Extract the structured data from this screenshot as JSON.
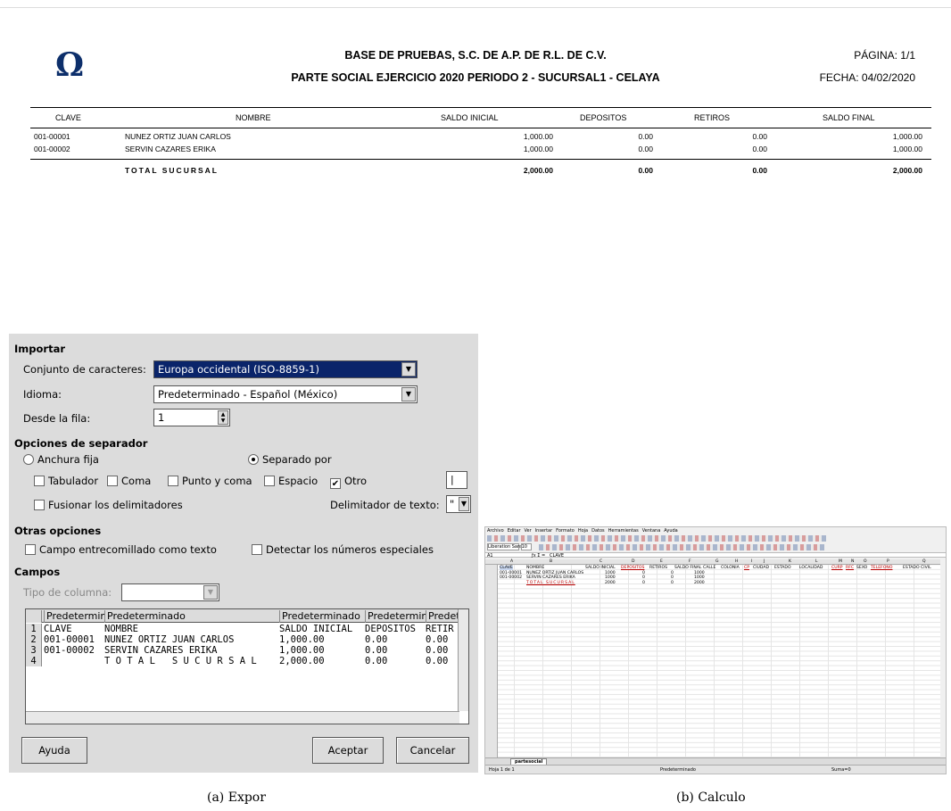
{
  "report": {
    "logo": "Ω",
    "title": "BASE DE PRUEBAS, S.C. DE A.P. DE R.L. DE C.V.",
    "subtitle": "PARTE SOCIAL EJERCICIO 2020 PERIODO 2 - SUCURSAL1 - CELAYA",
    "page": "PÁGINA: 1/1",
    "date": "FECHA: 04/02/2020",
    "columns": [
      "CLAVE",
      "NOMBRE",
      "SALDO INICIAL",
      "DEPOSITOS",
      "RETIROS",
      "SALDO FINAL"
    ],
    "rows": [
      [
        "001-00001",
        "NUNEZ ORTIZ JUAN CARLOS",
        "1,000.00",
        "0.00",
        "0.00",
        "1,000.00"
      ],
      [
        "001-00002",
        "SERVIN CAZARES ERIKA",
        "1,000.00",
        "0.00",
        "0.00",
        "1,000.00"
      ]
    ],
    "total": [
      "TOTAL SUCURSAL",
      "2,000.00",
      "0.00",
      "0.00",
      "2,000.00"
    ]
  },
  "dialog": {
    "section_import": "Importar",
    "charset_label": "Conjunto de caracteres:",
    "charset_value": "Europa occidental (ISO-8859-1)",
    "language_label": "Idioma:",
    "language_value": "Predeterminado - Español (México)",
    "from_row_label": "Desde la fila:",
    "from_row_value": "1",
    "section_separator": "Opciones de separador",
    "fixed_width": "Anchura fija",
    "separated_by": "Separado por",
    "tab": "Tabulador",
    "comma": "Coma",
    "semicolon": "Punto y coma",
    "space": "Espacio",
    "other": "Otro",
    "other_value": "|",
    "merge_delims": "Fusionar los delimitadores",
    "text_delim_label": "Delimitador de texto:",
    "text_delim_value": "\"",
    "section_other": "Otras opciones",
    "quoted_as_text": "Campo entrecomillado como texto",
    "detect_numbers": "Detectar los números especiales",
    "section_fields": "Campos",
    "column_type_label": "Tipo de columna:",
    "preview_headers": [
      "Predetermin",
      "Predeterminado",
      "Predeterminado",
      "Predetermin",
      "Predet"
    ],
    "preview_rows": [
      [
        "1",
        "CLAVE",
        "NOMBRE",
        "SALDO INICIAL",
        "DEPOSITOS",
        "RETIR"
      ],
      [
        "2",
        "001-00001",
        "NUNEZ ORTIZ JUAN CARLOS",
        "1,000.00",
        "0.00",
        "0.00"
      ],
      [
        "3",
        "001-00002",
        "SERVIN CAZARES ERIKA",
        "1,000.00",
        "0.00",
        "0.00"
      ],
      [
        "4",
        "",
        "T O T A L   S U C U R S A L",
        "2,000.00",
        "0.00",
        "0.00"
      ]
    ],
    "help_button": "Ayuda",
    "ok_button": "Aceptar",
    "cancel_button": "Cancelar"
  },
  "calc": {
    "menu": [
      "Archivo",
      "Editar",
      "Ver",
      "Insertar",
      "Formato",
      "Hoja",
      "Datos",
      "Herramientas",
      "Ventana",
      "Ayuda"
    ],
    "font": "Liberation Sans",
    "size": "10",
    "cell_ref": "A1",
    "formula": "CLAVE",
    "col_headers": [
      "A",
      "B",
      "C",
      "D",
      "E",
      "F",
      "G",
      "H",
      "I",
      "J",
      "K",
      "L",
      "M",
      "N",
      "O",
      "P",
      "Q"
    ],
    "header_row": [
      "CLAVE",
      "NOMBRE",
      "SALDO INICIAL",
      "DEPOSITOS",
      "RETIROS",
      "SALDO FINAL",
      "CALLE",
      "COLONIA",
      "CP",
      "CIUDAD",
      "ESTADO",
      "LOCALIDAD",
      "CURP",
      "RFC",
      "SEXO",
      "TELEFONO",
      "ESTADO CIVIL"
    ],
    "data_rows": [
      [
        "001-00001",
        "NUNEZ ORTIZ JUAN CARLOS",
        "1000",
        "0",
        "0",
        "1000"
      ],
      [
        "001-00002",
        "SERVIN CAZARES ERIKA",
        "1000",
        "0",
        "0",
        "1000"
      ],
      [
        "",
        "TOTAL SUCURSAL",
        "2000",
        "0",
        "0",
        "2000"
      ]
    ],
    "sheet_tab": "partesocial",
    "status_sheet": "Hoja 1 de 1",
    "status_style": "Predeterminado",
    "status_sum": "Suma=0"
  },
  "captions": {
    "a": "(a) Expor",
    "b": "(b) Calculo"
  }
}
